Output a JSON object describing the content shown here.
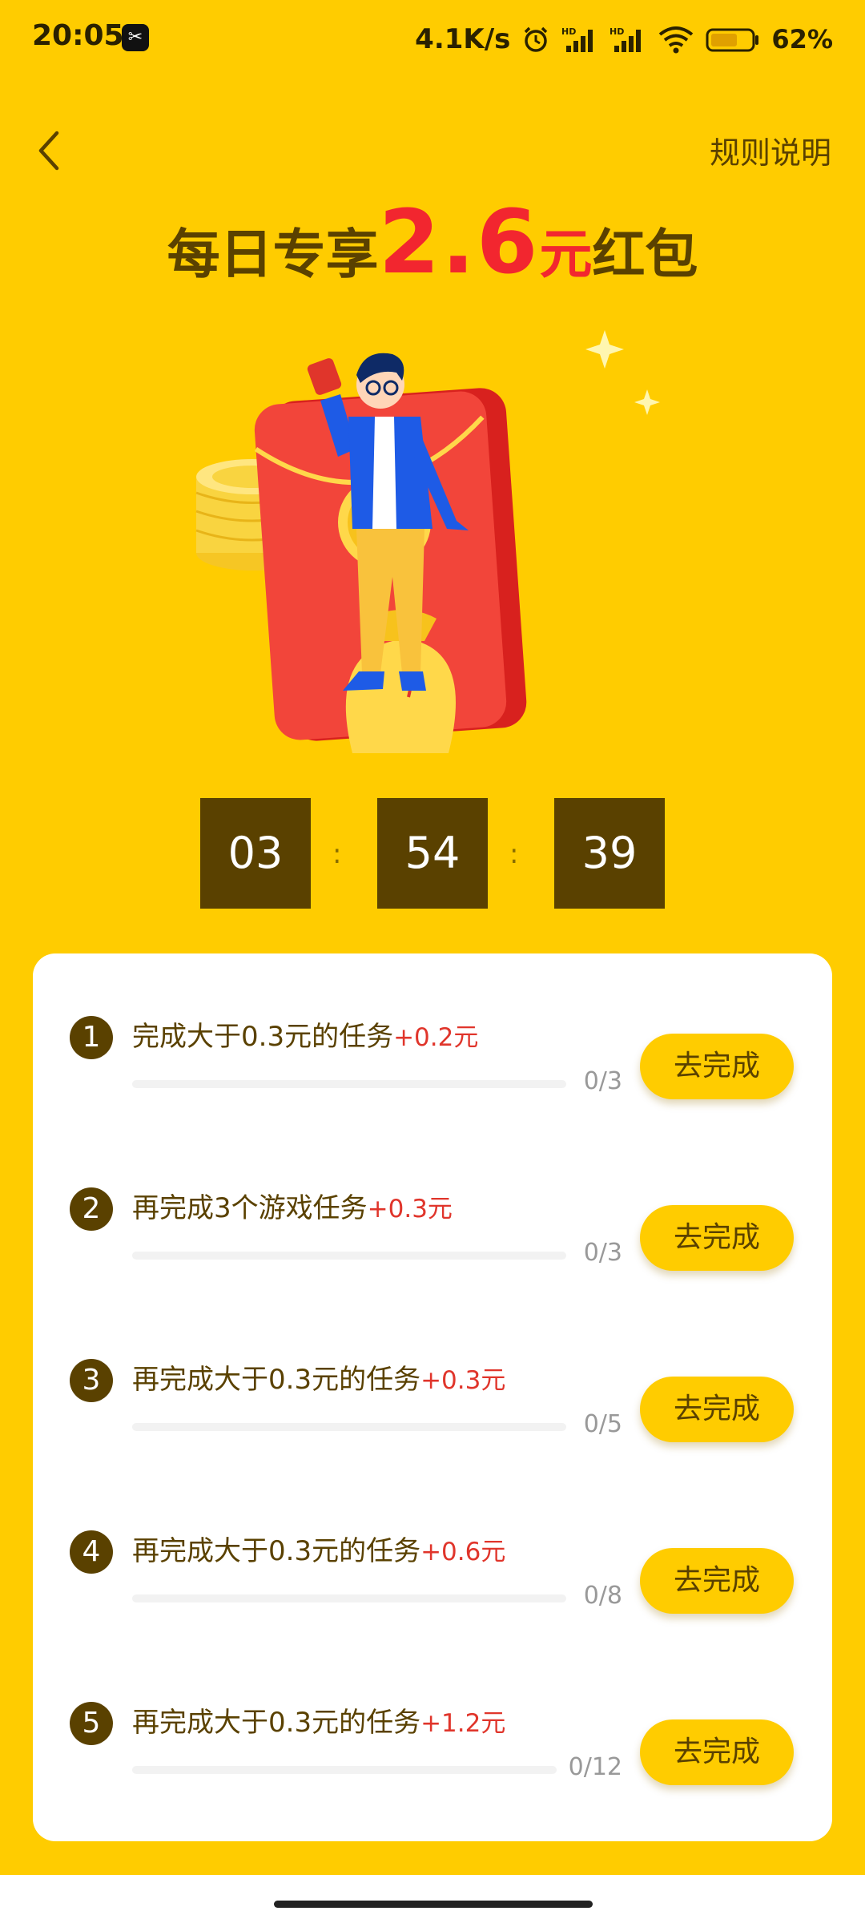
{
  "status_bar": {
    "time": "20:05",
    "app_icon": "capcut-icon",
    "speed": "4.1K/s",
    "icons": [
      "alarm-icon",
      "hd-signal-icon",
      "hd-signal-icon",
      "wifi-icon",
      "battery-icon"
    ],
    "battery": "62%"
  },
  "header": {
    "back_icon": "chevron-left-icon",
    "rules_label": "规则说明"
  },
  "headline": {
    "prefix": "每日专享",
    "amount": "2.6",
    "unit": "元",
    "suffix": "红包"
  },
  "countdown": {
    "hours": "03",
    "minutes": "54",
    "seconds": "39",
    "separator": ":"
  },
  "tasks": [
    {
      "number": "1",
      "title": "完成大于0.3元的任务",
      "reward": "+0.2元",
      "progress": "0/3",
      "fraction": 0,
      "button": "去完成"
    },
    {
      "number": "2",
      "title": "再完成3个游戏任务",
      "reward": "+0.3元",
      "progress": "0/3",
      "fraction": 0,
      "button": "去完成"
    },
    {
      "number": "3",
      "title": "再完成大于0.3元的任务",
      "reward": "+0.3元",
      "progress": "0/5",
      "fraction": 0,
      "button": "去完成"
    },
    {
      "number": "4",
      "title": "再完成大于0.3元的任务",
      "reward": "+0.6元",
      "progress": "0/8",
      "fraction": 0,
      "button": "去完成"
    },
    {
      "number": "5",
      "title": "再完成大于0.3元的任务",
      "reward": "+1.2元",
      "progress": "0/12",
      "fraction": 0,
      "button": "去完成"
    }
  ],
  "colors": {
    "background": "#FFCC00",
    "text_brown": "#5A4100",
    "accent_red": "#F2262F"
  }
}
